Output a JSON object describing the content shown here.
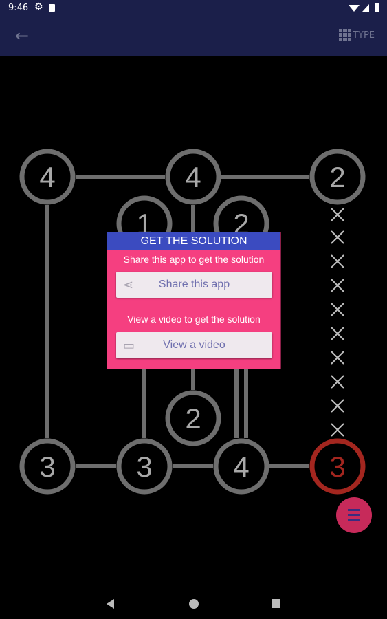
{
  "status_bar": {
    "time": "9:46"
  },
  "app_bar": {
    "type_label": "TYPE"
  },
  "puzzle": {
    "colors": {
      "line": "#6e6e6e",
      "node_stroke": "#6e6e6e",
      "node_text": "#a8a8a8",
      "active": "#a3261f",
      "cross": "#bfbfbf"
    },
    "nodes": [
      {
        "id": "n1",
        "value": "4"
      },
      {
        "id": "n2",
        "value": "4"
      },
      {
        "id": "n3",
        "value": "2"
      },
      {
        "id": "n4",
        "value": "1"
      },
      {
        "id": "n5",
        "value": "2"
      },
      {
        "id": "n6",
        "value": "2"
      },
      {
        "id": "n7",
        "value": "3"
      },
      {
        "id": "n8",
        "value": "3"
      },
      {
        "id": "n9",
        "value": "4"
      },
      {
        "id": "n10",
        "value": "3",
        "active": true
      }
    ],
    "crosses_count": 10
  },
  "dialog": {
    "title": "GET THE SOLUTION",
    "share_text": "Share this app to get the solution",
    "share_button": "Share this app",
    "video_text": "View a video to get the solution",
    "video_button": "View a video"
  },
  "colors": {
    "appbar": "#1b1f4a",
    "dialog_bg": "#f53f80",
    "dialog_title_bg": "#3b4bc0",
    "fab": "#c72a5a"
  }
}
